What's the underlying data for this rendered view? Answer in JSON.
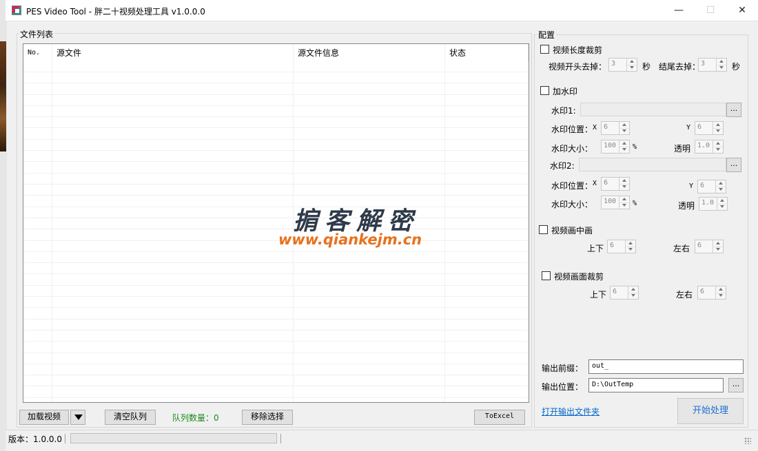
{
  "window": {
    "title": "PES Video Tool - 胖二十视频处理工具 v1.0.0.0",
    "minimize": "—",
    "maximize": "☐",
    "close": "✕"
  },
  "file_list": {
    "group_label": "文件列表",
    "columns": [
      "No.",
      "源文件",
      "源文件信息",
      "状态"
    ]
  },
  "watermark_overlay": {
    "title": "掮客解密",
    "url": "www.qiankejm.cn"
  },
  "bottom_bar": {
    "load_video": "加载视频",
    "clear_queue": "清空队列",
    "queue_count_label": "队列数量：",
    "queue_count": "0",
    "remove_selected": "移除选择",
    "to_excel": "ToExcel"
  },
  "config": {
    "group_label": "配置",
    "trim": {
      "label": "视频长度裁剪",
      "start_label": "视频开头去掉：",
      "start_value": "3",
      "sec1": "秒",
      "end_label": "结尾去掉：",
      "end_value": "3",
      "sec2": "秒"
    },
    "watermark": {
      "label": "加水印",
      "wm1_label": "水印1:",
      "wm1_browse": "...",
      "wm1_pos_label": "水印位置：",
      "wm1_x_label": "X",
      "wm1_x": "6",
      "wm1_y_label": "Y",
      "wm1_y": "6",
      "wm1_size_label": "水印大小：",
      "wm1_size": "100",
      "wm1_pct": "%",
      "wm1_opacity_label": "透明",
      "wm1_opacity": "1.0",
      "wm2_label": "水印2:",
      "wm2_browse": "...",
      "wm2_pos_label": "水印位置：",
      "wm2_x_label": "X",
      "wm2_x": "6",
      "wm2_y_label": "Y",
      "wm2_y": "6",
      "wm2_size_label": "水印大小：",
      "wm2_size": "100",
      "wm2_pct": "%",
      "wm2_opacity_label": "透明",
      "wm2_opacity": "1.0"
    },
    "pip": {
      "label": "视频画中画",
      "updown_label": "上下",
      "updown": "6",
      "leftright_label": "左右",
      "leftright": "6"
    },
    "crop": {
      "label": "视频画面裁剪",
      "updown_label": "上下",
      "updown": "6",
      "leftright_label": "左右",
      "leftright": "6"
    },
    "output": {
      "prefix_label": "输出前缀：",
      "prefix_value": "out_",
      "location_label": "输出位置：",
      "location_value": "D:\\OutTemp",
      "browse": "...",
      "open_folder": "打开输出文件夹",
      "start": "开始处理"
    }
  },
  "status": {
    "version_label": "版本：",
    "version": "1.0.0.0"
  }
}
